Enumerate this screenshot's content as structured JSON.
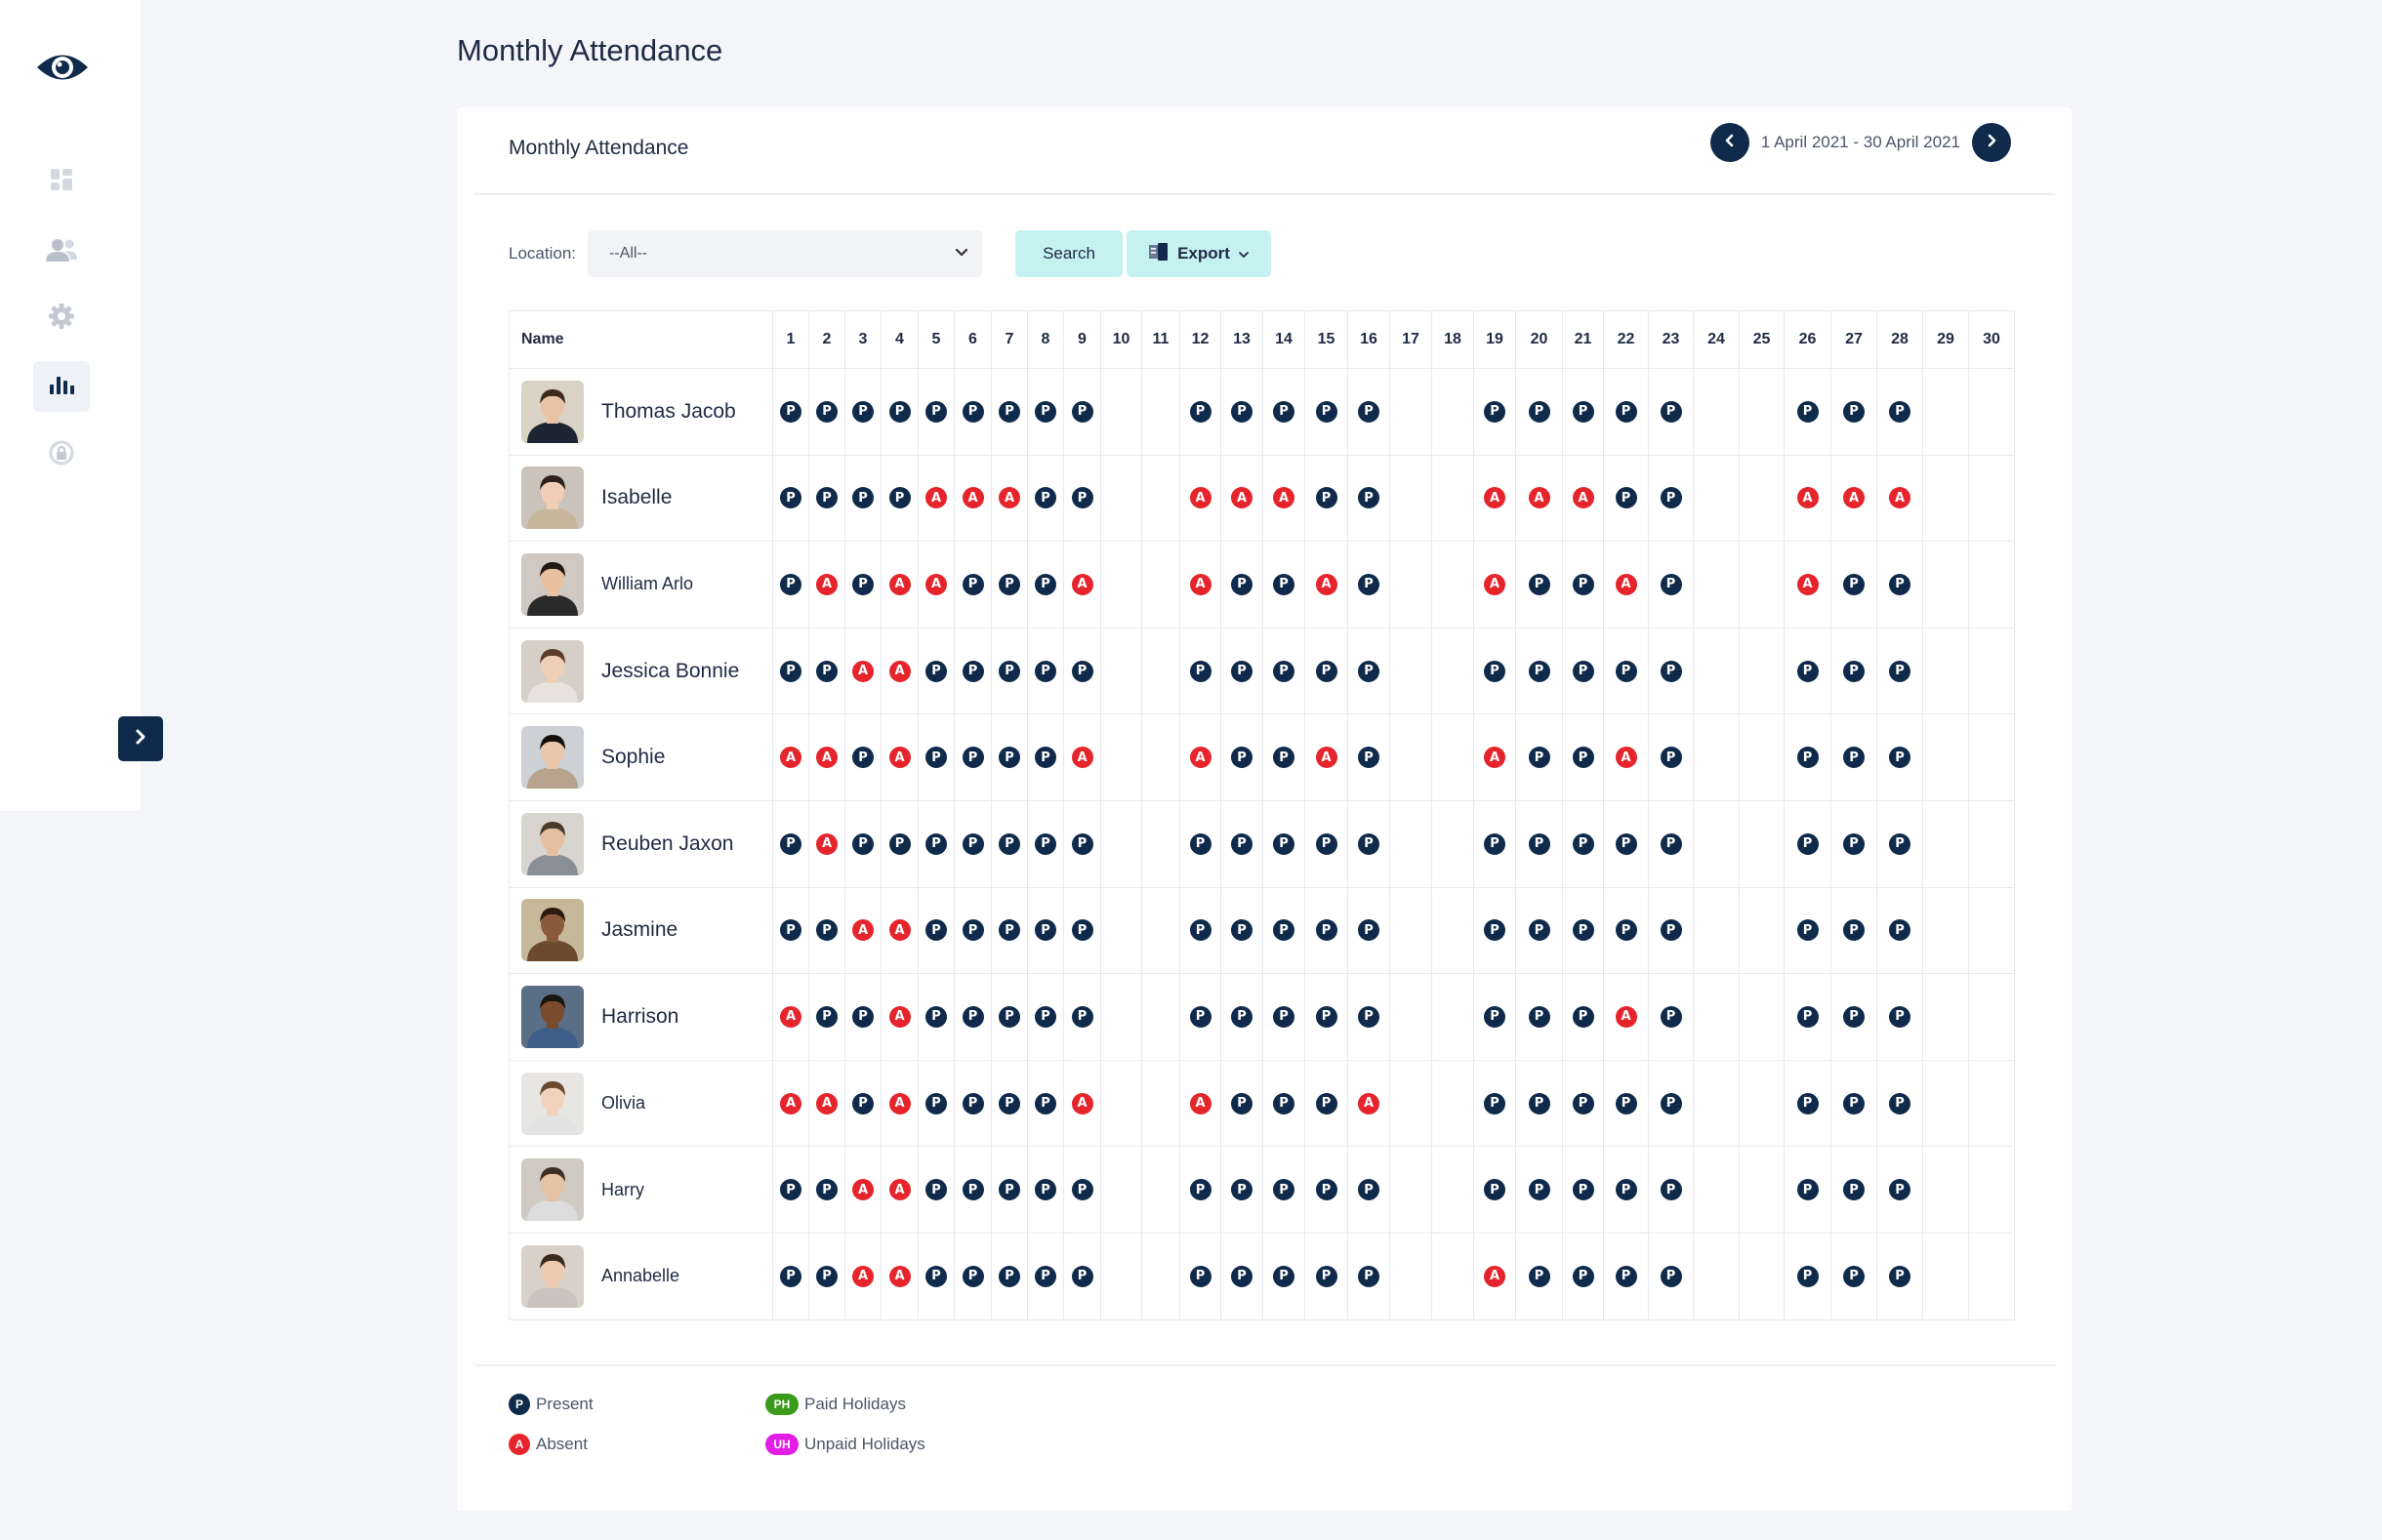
{
  "page": {
    "title": "Monthly Attendance"
  },
  "sidebar": {
    "items": [
      {
        "name": "dashboard-icon"
      },
      {
        "name": "users-icon"
      },
      {
        "name": "gear-icon"
      },
      {
        "name": "bar-chart-icon",
        "active": true
      },
      {
        "name": "lock-icon"
      }
    ]
  },
  "card": {
    "title": "Monthly Attendance",
    "date_range": "1 April 2021 - 30 April 2021"
  },
  "filters": {
    "location_label": "Location:",
    "location_value": "--All--",
    "search_label": "Search",
    "export_label": "Export"
  },
  "table": {
    "name_header": "Name",
    "days": [
      "1",
      "2",
      "3",
      "4",
      "5",
      "6",
      "7",
      "8",
      "9",
      "10",
      "11",
      "12",
      "13",
      "14",
      "15",
      "16",
      "17",
      "18",
      "19",
      "20",
      "21",
      "22",
      "23",
      "24",
      "25",
      "26",
      "27",
      "28",
      "29",
      "30"
    ],
    "rows": [
      {
        "name": "Thomas Jacob",
        "att": "PPPPPPPPP--PPPPP--PPPPP--PPP--"
      },
      {
        "name": "Isabelle",
        "att": "PPPPAAAPP--AAAPP--AAAPP--AAA--"
      },
      {
        "name": "William Arlo",
        "att": "PAPAAPPPA--APPAP--APPAP--APP--"
      },
      {
        "name": "Jessica Bonnie",
        "att": "PPAAPPPPP--PPPPP--PPPPP--PPP--"
      },
      {
        "name": "Sophie",
        "att": "AAPAPPPPA--APPAP--APPAP--PPP--"
      },
      {
        "name": "Reuben Jaxon",
        "att": "PAPPPPPPP--PPPPP--PPPPP--PPP--"
      },
      {
        "name": "Jasmine",
        "att": "PPAAPPPPP--PPPPP--PPPPP--PPP--"
      },
      {
        "name": "Harrison",
        "att": "APPAPPPPP--PPPPP--PPPAP--PPP--"
      },
      {
        "name": "Olivia",
        "att": "AAPAPPPPA--APPPA--PPPPP--PPP--"
      },
      {
        "name": "Harry",
        "att": "PPAAPPPPP--PPPPP--PPPPP--PPP--"
      },
      {
        "name": "Annabelle",
        "att": "PPAAPPPPP--PPPPP--APPPP--PPP--"
      }
    ]
  },
  "legend": {
    "present_code": "P",
    "present_label": "Present",
    "absent_code": "A",
    "absent_label": "Absent",
    "paid_code": "PH",
    "paid_label": "Paid Holidays",
    "unpaid_code": "UH",
    "unpaid_label": "Unpaid Holidays"
  },
  "colors": {
    "present": "#0f2a4a",
    "absent": "#e5242b",
    "paid_holiday": "#3a9b1a",
    "unpaid_holiday": "#e21ee6",
    "accent_button": "#c6f1f1"
  }
}
